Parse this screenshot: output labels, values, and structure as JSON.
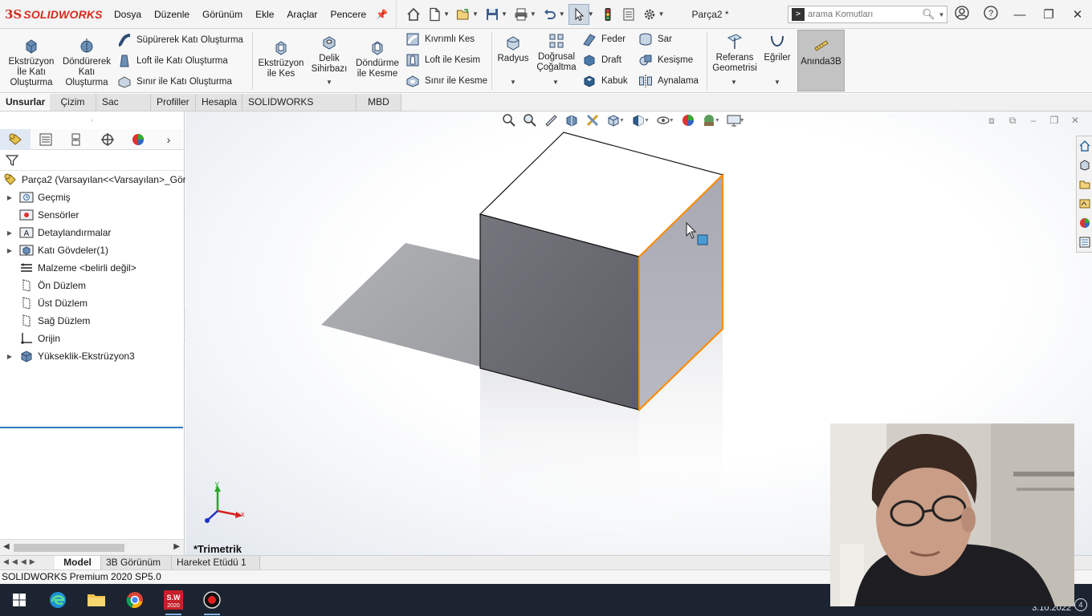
{
  "app": {
    "brand_ds": "3S",
    "brand_name": "SOLIDWORKS",
    "doc_title": "Parça2 *"
  },
  "menu": [
    "Dosya",
    "Düzenle",
    "Görünüm",
    "Ekle",
    "Araçlar",
    "Pencere"
  ],
  "search": {
    "placeholder": "arama Komutları"
  },
  "ribbon": {
    "extrude_boss": "Ekstrüzyon İle Katı Oluşturma",
    "revolve_boss": "Döndürerek Katı Oluşturma",
    "swept_boss": "Süpürerek Katı Oluşturma",
    "loft_boss": "Loft ile Katı Oluşturma",
    "boundary_boss": "Sınır ile Katı Oluşturma",
    "extrude_cut": "Ekstrüzyon ile Kes",
    "hole_wizard": "Delik Sihirbazı",
    "revolve_cut": "Döndürme ile Kesme",
    "swept_cut": "Kıvrımlı Kes",
    "loft_cut": "Loft ile Kesim",
    "boundary_cut": "Sınır ile Kesme",
    "fillet": "Radyus",
    "linear_pattern": "Doğrusal Çoğaltma",
    "rib": "Feder",
    "draft": "Draft",
    "shell": "Kabuk",
    "wrap": "Sar",
    "intersect": "Kesişme",
    "mirror": "Aynalama",
    "ref_geometry": "Referans Geometrisi",
    "curves": "Eğriler",
    "instant3d": "Anında3B"
  },
  "command_tabs": [
    "Unsurlar",
    "Çizim",
    "Sac Levha",
    "Profiller",
    "Hesapla",
    "SOLIDWORKS Eklentileri",
    "MBD"
  ],
  "feature_tree": {
    "root": "Parça2  (Varsayılan<<Varsayılan>_Gör",
    "items": [
      {
        "label": "Geçmiş",
        "expandable": true,
        "icon": "history-icon"
      },
      {
        "label": "Sensörler",
        "expandable": false,
        "icon": "sensor-icon"
      },
      {
        "label": "Detaylandırmalar",
        "expandable": true,
        "icon": "annotation-icon"
      },
      {
        "label": "Katı Gövdeler(1)",
        "expandable": true,
        "icon": "solid-bodies-icon"
      },
      {
        "label": "Malzeme <belirli değil>",
        "expandable": false,
        "icon": "material-icon"
      },
      {
        "label": "Ön Düzlem",
        "expandable": false,
        "icon": "plane-icon"
      },
      {
        "label": "Üst Düzlem",
        "expandable": false,
        "icon": "plane-icon"
      },
      {
        "label": "Sağ Düzlem",
        "expandable": false,
        "icon": "plane-icon"
      },
      {
        "label": "Orijin",
        "expandable": false,
        "icon": "origin-icon"
      },
      {
        "label": "Yükseklik-Ekstrüzyon3",
        "expandable": true,
        "icon": "extrude-feature-icon"
      }
    ]
  },
  "viewport": {
    "view_name": "*Trimetrik",
    "axis_labels": {
      "x": "x",
      "y": "y"
    },
    "highlight_color": "#ff8c00"
  },
  "model_tabs": [
    "Model",
    "3B Görünüm",
    "Hareket Etüdü 1"
  ],
  "status_bar": {
    "text": "SOLIDWORKS Premium 2020 SP5.0"
  },
  "taskbar": {
    "apps": [
      "start-icon",
      "edge-icon",
      "file-explorer-icon",
      "chrome-icon",
      "solidworks-2020-icon",
      "record-icon"
    ],
    "sw_badge": "S.W\n2020",
    "date": "3.10.2022",
    "notifications": "4"
  },
  "colors": {
    "brand_red": "#d52b1e",
    "selection_blue": "#2f7bbf",
    "taskbar_bg": "#1b2430"
  }
}
